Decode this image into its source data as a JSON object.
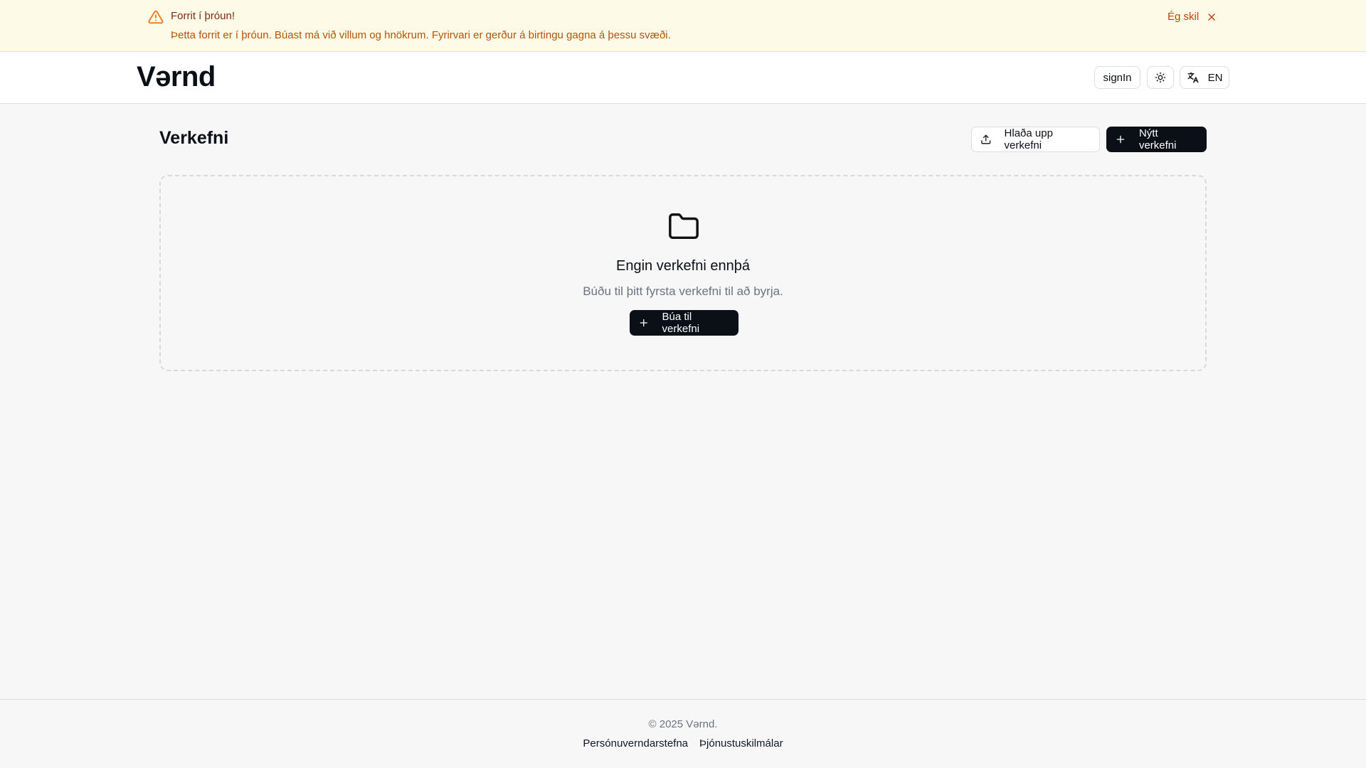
{
  "banner": {
    "title": "Forrit í þróun!",
    "description": "Þetta forrit er í þróun. Búast má við villum og hnökrum. Fyrirvari er gerður á birtingu gagna á þessu svæði.",
    "ack_label": "Ég skil"
  },
  "header": {
    "logo": "Vərnd",
    "signin_label": "signIn",
    "language_label": "EN"
  },
  "main": {
    "title": "Verkefni",
    "upload_label": "Hlaða upp verkefni",
    "new_label": "Nýtt verkefni",
    "empty": {
      "heading": "Engin verkefni ennþá",
      "subtext": "Búðu til þitt fyrsta verkefni til að byrja.",
      "create_label": "Búa til verkefni"
    }
  },
  "footer": {
    "copyright": "© 2025 Vərnd.",
    "links": [
      "Persónuverndarstefna",
      "Þjónustuskilmálar"
    ]
  }
}
